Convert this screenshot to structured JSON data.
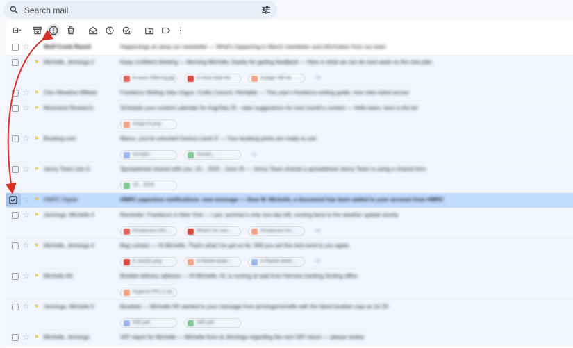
{
  "search": {
    "placeholder": "Search mail",
    "icon": "search-icon",
    "filter_icon": "tune-icon"
  },
  "toolbar": {
    "buttons": [
      {
        "name": "select-all-checkbox",
        "icon": "checkbox-dropdown-icon"
      },
      {
        "name": "archive-button",
        "icon": "archive-icon"
      },
      {
        "name": "report-spam-button",
        "icon": "report-spam-icon"
      },
      {
        "name": "delete-button",
        "icon": "trash-icon"
      },
      {
        "name": "mark-as-read-button",
        "icon": "envelope-open-icon"
      },
      {
        "name": "snooze-button",
        "icon": "clock-icon"
      },
      {
        "name": "add-to-tasks-button",
        "icon": "task-check-icon"
      },
      {
        "name": "move-to-button",
        "icon": "folder-move-icon"
      },
      {
        "name": "labels-button",
        "icon": "label-icon"
      },
      {
        "name": "more-options-button",
        "icon": "more-vert-icon"
      }
    ]
  },
  "colors": {
    "accent": "#d93025",
    "selected_row": "#c2dbff",
    "important": "#f2b600"
  },
  "emails": [
    {
      "sender": "Wolf Creek Ranch",
      "subject": "Happenings at camp our newsletter — What's happening in March newsletter and information from our team",
      "read": false,
      "important": false,
      "chips": []
    },
    {
      "sender": "Michelle, Jennings 2",
      "subject": "Keep confident thinking — Morning Michelle, thanks for getting feedback — Here is what we can do next week on the new plan",
      "read": true,
      "important": true,
      "chips": [
        "A news Offering.jpg",
        "A news lead list.",
        "A page HM eit"
      ],
      "more": "+3"
    },
    {
      "sender": "Cleo Meadow Affiliate",
      "subject": "Freelance Writing Jobs Vogue, Crafts Council, Heritable — This year's freelance writing guide, new roles listed across",
      "read": true,
      "important": true,
      "chips": []
    },
    {
      "sender": "Moonshot Research",
      "subject": "Schedule your content calendar for Aug/Sep 25 - topic suggestions for next month's content — Hello team, here is the list",
      "read": true,
      "important": true,
      "chips": [
        "image15.png"
      ]
    },
    {
      "sender": "Booking.com",
      "subject": "Marco, you've unlocked Genius Level 2! — Your booking perks are ready to use",
      "read": true,
      "important": true,
      "chips": [
        "receipts",
        "receipt_..."
      ],
      "more": "+1"
    },
    {
      "sender": "Jenny Team (via G.",
      "subject": "Spreadsheet shared with you: 10... 2025 - June 25 — Jenny Team shared a spreadsheet Jenny Team is using a shared form",
      "read": true,
      "important": true,
      "chips": [
        "10... 2025"
      ]
    },
    {
      "sender": "HMRC Digital",
      "subject": "HMRC paperless notifications: new message — Dear M. Michelle, a document has been added to your account from HMRC",
      "read": true,
      "important": true,
      "selected": true,
      "chips": []
    },
    {
      "sender": "Jennings, Michelle 4",
      "subject": "Reminder: Freelance in New York — Last, summer's only one day left, coming back to the weather update shortly",
      "read": true,
      "important": true,
      "chips": [
        "Restaurant 202...",
        "What's for sea...",
        "Restaurant loc..."
      ],
      "more": "+2"
    },
    {
      "sender": "Michelle, Jennings 4",
      "subject": "Bag contact — Hi Michelle, That's what I've got so far. Will you set this and send to you again.",
      "read": true,
      "important": true,
      "chips": [
        "A 1et181.png",
        "A Packer.book...",
        "A Packer.book..."
      ],
      "more": "+2"
    },
    {
      "sender": "Michelle KK",
      "subject": "Booklet delivery address — Hi Michelle, Hi, is coming at wait from Hermes tracking Sorting office",
      "read": true,
      "important": true,
      "chips": [
        "Hygiene PP1.1.xls"
      ]
    },
    {
      "sender": "Jennings, Michelle 5",
      "subject": "Booklets — Michelle HK wanted to your message from jenningsmichelle with the latest booklet copy at Jul 29",
      "read": true,
      "important": true,
      "chips": [
        "IMG.pdf",
        "IMG.pdf"
      ]
    },
    {
      "sender": "Michelle, Jennings",
      "subject": "VAT report for Michelle — Michelle from at Jennings regarding the next VAT return — please review",
      "read": true,
      "important": true,
      "chips": []
    }
  ]
}
